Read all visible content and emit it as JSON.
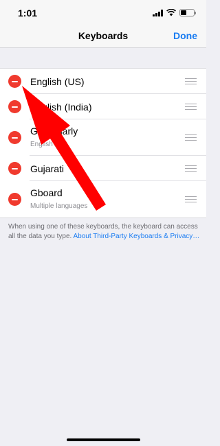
{
  "status_bar": {
    "time": "1:01",
    "icons": [
      "cellular-signal-icon",
      "wifi-icon",
      "battery-icon"
    ]
  },
  "nav": {
    "title": "Keyboards",
    "done_label": "Done"
  },
  "keyboards": [
    {
      "name": "English (US)",
      "subtitle": ""
    },
    {
      "name": "English (India)",
      "subtitle": ""
    },
    {
      "name": "Grammarly",
      "subtitle": "English"
    },
    {
      "name": "Gujarati",
      "subtitle": ""
    },
    {
      "name": "Gboard",
      "subtitle": "Multiple languages"
    }
  ],
  "footer": {
    "text": "When using one of these keyboards, the keyboard can access all the data you type. ",
    "link": "About Third-Party Keyboards & Privacy…"
  },
  "colors": {
    "accent": "#1a7cf2",
    "delete": "#f03a2e",
    "annotation_arrow": "#ff0000",
    "background": "#efeff4"
  }
}
